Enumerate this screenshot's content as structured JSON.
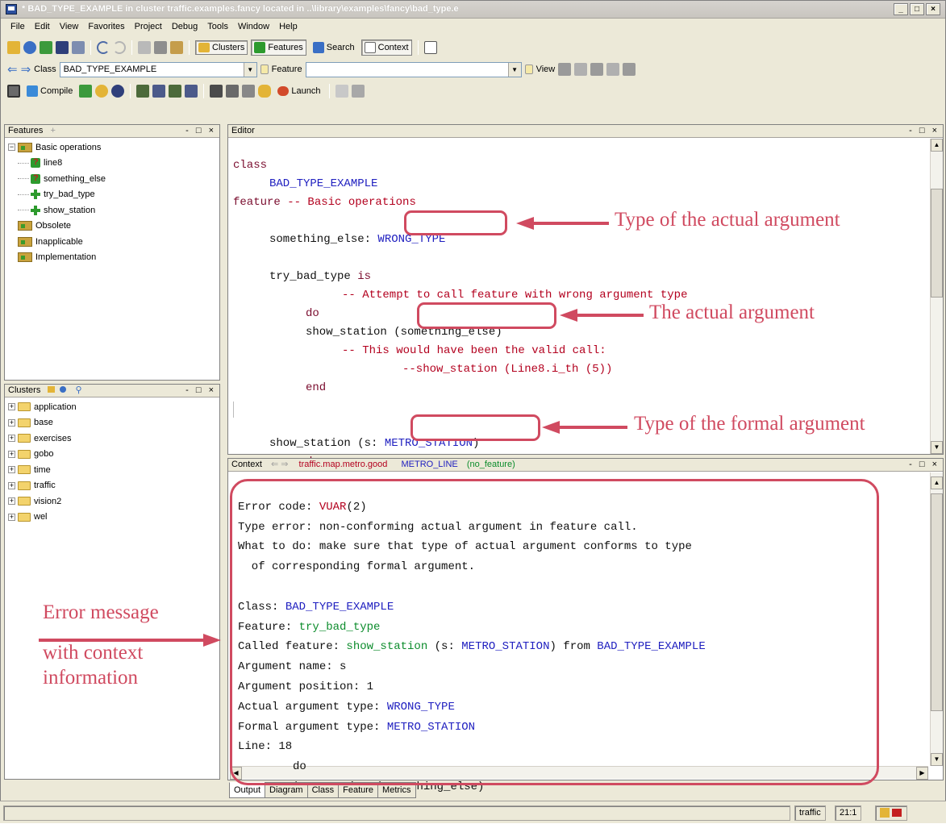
{
  "window": {
    "title": "* BAD_TYPE_EXAMPLE  in cluster traffic.examples.fancy  located in ..\\library\\examples\\fancy\\bad_type.e"
  },
  "menu": [
    "File",
    "Edit",
    "View",
    "Favorites",
    "Project",
    "Debug",
    "Tools",
    "Window",
    "Help"
  ],
  "toolbar1": {
    "clusters_label": "Clusters",
    "features_label": "Features",
    "search_label": "Search",
    "context_label": "Context"
  },
  "toolbar2": {
    "class_label": "Class",
    "class_value": "BAD_TYPE_EXAMPLE",
    "feature_label": "Feature",
    "feature_value": "",
    "view_label": "View"
  },
  "toolbar3": {
    "compile_label": "Compile",
    "launch_label": "Launch"
  },
  "features_panel": {
    "title": "Features",
    "items": [
      {
        "label": "Basic operations"
      },
      {
        "label": "line8"
      },
      {
        "label": "something_else"
      },
      {
        "label": "try_bad_type"
      },
      {
        "label": "show_station"
      },
      {
        "label": "Obsolete"
      },
      {
        "label": "Inapplicable"
      },
      {
        "label": "Implementation"
      }
    ]
  },
  "clusters_panel": {
    "title": "Clusters",
    "items": [
      "application",
      "base",
      "exercises",
      "gobo",
      "time",
      "traffic",
      "vision2",
      "wel"
    ]
  },
  "editor": {
    "title": "Editor",
    "lines": {
      "l1": "class",
      "l2": "BAD_TYPE_EXAMPLE",
      "l3a": "feature",
      "l3b": " -- Basic operations",
      "l4a": "something_else: ",
      "l4b": "WRONG_TYPE",
      "l5a": "try_bad_type ",
      "l5b": "is",
      "l6": "-- Attempt to call feature with wrong argument type",
      "l7": "do",
      "l8": "show_station (something_else)",
      "l9": "-- This would have been the valid call:",
      "l10": "--show_station (Line8.i_th (5))",
      "l11": "end",
      "l12a": "show_station (s: ",
      "l12b": "METRO_STATION",
      "l12c": ")",
      "l13": "do"
    }
  },
  "context_panel": {
    "title": "Context",
    "path": "traffic.map.metro.good",
    "class_name": "METRO_LINE",
    "feature": "(no_feature)"
  },
  "output": {
    "error_code_label": "Error code: ",
    "error_code": "VUAR",
    "error_code_num": "(2)",
    "line2": "Type error: non-conforming actual argument in feature call.",
    "line3": "What to do: make sure that type of actual argument conforms to type",
    "line4": "  of corresponding formal argument.",
    "class_label": "Class: ",
    "class_value": "BAD_TYPE_EXAMPLE",
    "feature_label": "Feature: ",
    "feature_value": "try_bad_type",
    "called_label": "Called feature: ",
    "called_fn": "show_station",
    "called_sig": " (s: ",
    "called_type": "METRO_STATION",
    "called_from": ") from ",
    "called_class": "BAD_TYPE_EXAMPLE",
    "arg_name": "Argument name: s",
    "arg_pos": "Argument position: 1",
    "actual_label": "Actual argument type: ",
    "actual_value": "WRONG_TYPE",
    "formal_label": "Formal argument type: ",
    "formal_value": "METRO_STATION",
    "line_label": "Line: 18",
    "do_line": "do",
    "arrow": "->",
    "call_line": "show_station (something_else)"
  },
  "bottom_tabs": [
    "Output",
    "Diagram",
    "Class",
    "Feature",
    "Metrics"
  ],
  "status": {
    "cluster": "traffic",
    "position": "21:1"
  },
  "annotations": {
    "a1": "Type of the actual argument",
    "a2": "The actual argument",
    "a3": "Type of the formal argument",
    "a4_line1": "Error message",
    "a4_line2": "with context",
    "a4_line3": "information"
  },
  "colors": {
    "annotation": "#d04a60",
    "keyword": "#7a0c2e",
    "class_name": "#2020c0",
    "comment": "#b3001e",
    "feature_name": "#0c8c2c"
  }
}
